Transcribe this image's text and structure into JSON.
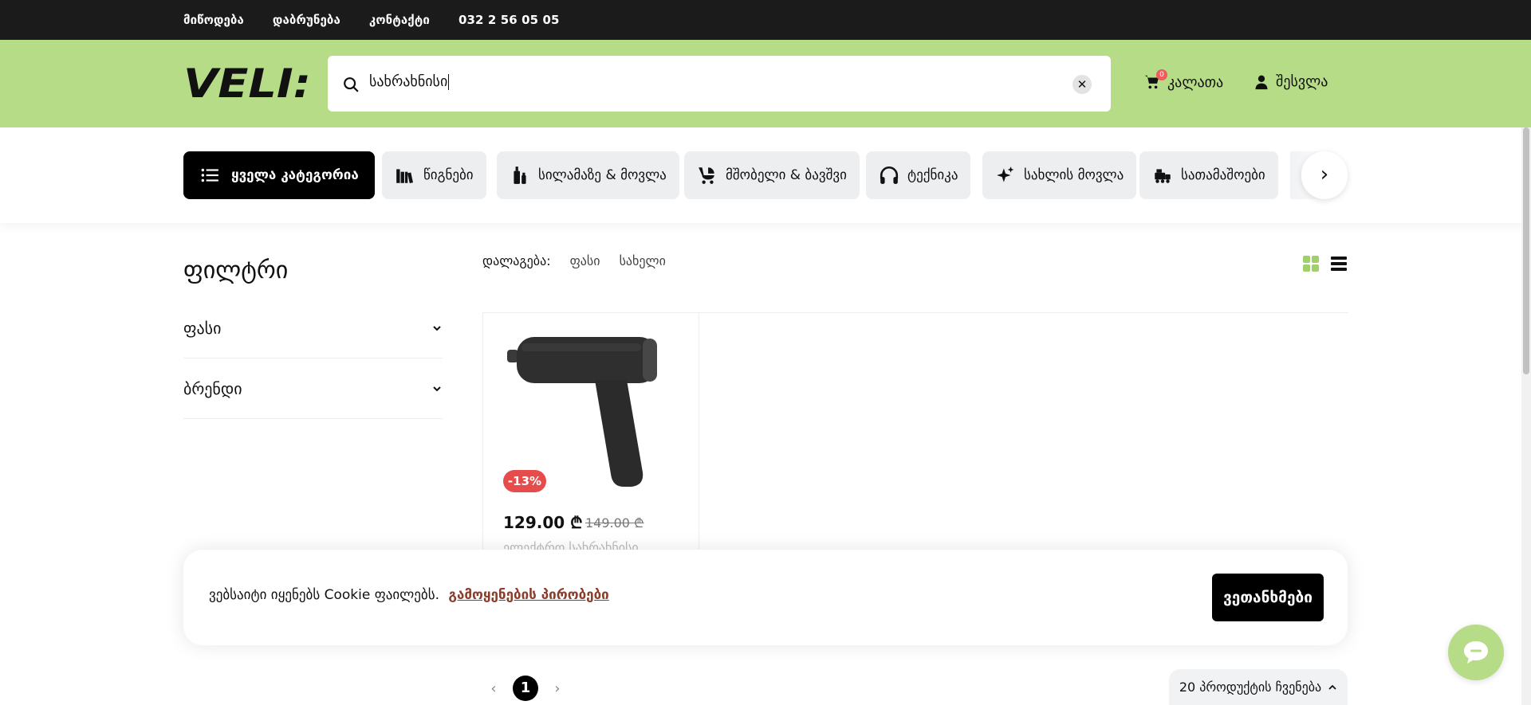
{
  "topbar": {
    "links": [
      "მიწოდება",
      "დაბრუნება",
      "კონტაქტი",
      "032 2 56 05 05"
    ]
  },
  "header": {
    "logo_text": "VELI:",
    "search_value": "სახრახნისი",
    "cart_label": "კალათა",
    "cart_count": "0",
    "login_label": "შესვლა",
    "colors": {
      "brand_green": "#b6dc88",
      "topbar": "#1b1b1b"
    }
  },
  "categories": [
    {
      "label": "ყველა კატეგორია",
      "icon": "list-icon"
    },
    {
      "label": "წიგნები",
      "icon": "books-icon"
    },
    {
      "label": "სილამაზე & მოვლა",
      "icon": "cosmetics-icon"
    },
    {
      "label": "მშობელი & ბავშვი",
      "icon": "stroller-icon"
    },
    {
      "label": "ტექნიკა",
      "icon": "headphones-icon"
    },
    {
      "label": "სახლის მოვლა",
      "icon": "sparkle-icon"
    },
    {
      "label": "სათამაშოები",
      "icon": "toy-train-icon"
    }
  ],
  "filters": {
    "title": "ფილტრი",
    "groups": [
      "ფასი",
      "ბრენდი"
    ]
  },
  "sort": {
    "label": "დალაგება:",
    "options": [
      "ფასი",
      "სახელი"
    ]
  },
  "product": {
    "discount": "-13%",
    "price": "129.00 ₾",
    "old_price": "149.00 ₾",
    "name": "ელექტრო სახრახნისი"
  },
  "cookie": {
    "text": "ვებსაიტი იყენებს Cookie ფაილებს.",
    "link": "გამოყენების პირობები",
    "agree": "ვეთანხმები"
  },
  "pagination": {
    "current": "1",
    "per_page": "20 პროდუქტის ჩვენება"
  }
}
